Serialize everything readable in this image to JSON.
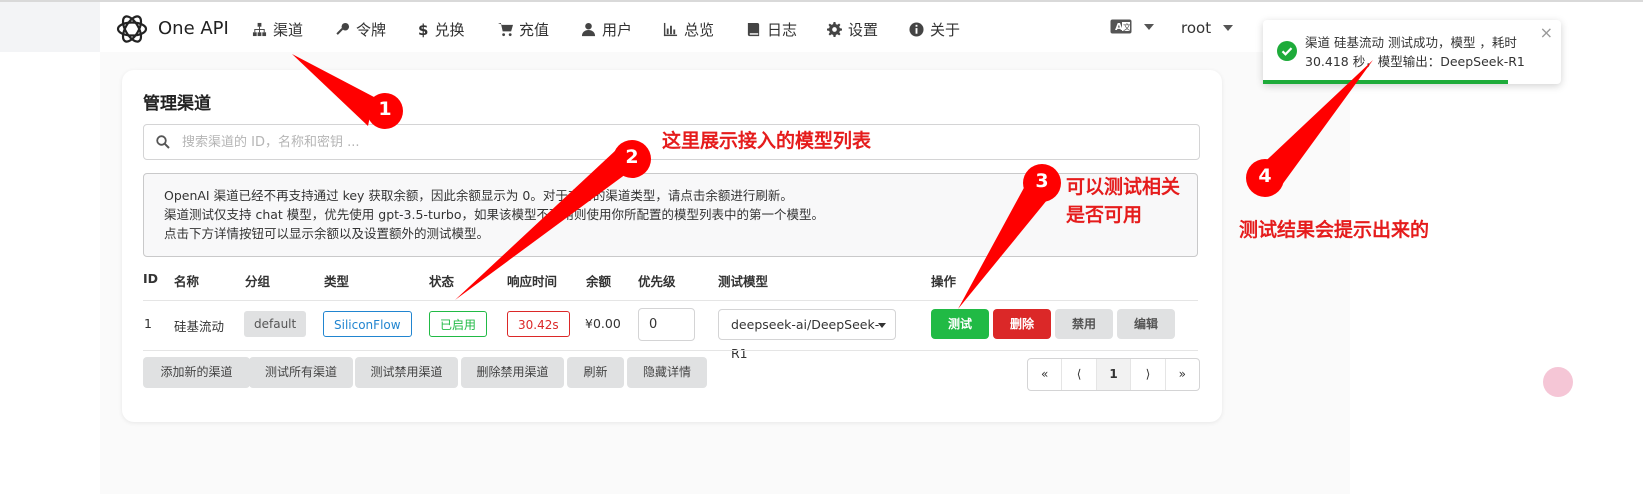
{
  "nav": {
    "brand": "One API",
    "items": [
      {
        "label": "渠道",
        "icon": "sitemap-icon"
      },
      {
        "label": "令牌",
        "icon": "key-icon"
      },
      {
        "label": "兑换",
        "icon": "dollar-icon"
      },
      {
        "label": "充值",
        "icon": "cart-icon"
      },
      {
        "label": "用户",
        "icon": "user-icon"
      },
      {
        "label": "总览",
        "icon": "bar-chart-icon"
      },
      {
        "label": "日志",
        "icon": "book-icon"
      },
      {
        "label": "设置",
        "icon": "gear-icon"
      },
      {
        "label": "关于",
        "icon": "info-icon"
      }
    ],
    "username": "root"
  },
  "page": {
    "title": "管理渠道",
    "search_placeholder": "搜索渠道的 ID，名称和密钥 ..."
  },
  "notice": {
    "line1": "OpenAI 渠道已经不再支持通过 key 获取余额，因此余额显示为 0。对于支持的渠道类型，请点击余额进行刷新。",
    "line2": "渠道测试仅支持 chat 模型，优先使用 gpt-3.5-turbo，如果该模型不可用则使用你所配置的模型列表中的第一个模型。",
    "line3": "点击下方详情按钮可以显示余额以及设置额外的测试模型。"
  },
  "table": {
    "headers": [
      "ID",
      "名称",
      "分组",
      "类型",
      "状态",
      "响应时间",
      "余额",
      "优先级",
      "测试模型",
      "操作"
    ],
    "row": {
      "id": "1",
      "name": "硅基流动",
      "group": "default",
      "type": "SiliconFlow",
      "status": "已启用",
      "response_time": "30.42s",
      "balance": "¥0.00",
      "priority": "0",
      "test_model": "deepseek-ai/DeepSeek-R1",
      "actions": {
        "test": "测试",
        "delete": "删除",
        "disable": "禁用",
        "edit": "编辑"
      }
    }
  },
  "footer_buttons": [
    "添加新的渠道",
    "测试所有渠道",
    "测试禁用渠道",
    "删除禁用渠道",
    "刷新",
    "隐藏详情"
  ],
  "pagination": [
    "«",
    "⟨",
    "1",
    "⟩",
    "»"
  ],
  "toast": {
    "message": "渠道 硅基流动 测试成功，模型 ，耗时 30.418 秒，模型输出：DeepSeek-R1",
    "close": "×"
  },
  "annotations": {
    "n1": "1",
    "n2": "2",
    "n3": "3",
    "n4": "4",
    "text2": "这里展示接入的模型列表",
    "text3_line1": "可以测试相关",
    "text3_line2": "是否可用",
    "text4": "测试结果会提示出来的"
  },
  "colors": {
    "success": "#21ba45",
    "danger": "#db2828",
    "annotation": "#ff0000",
    "siliconflow_blue": "#2185d0"
  }
}
